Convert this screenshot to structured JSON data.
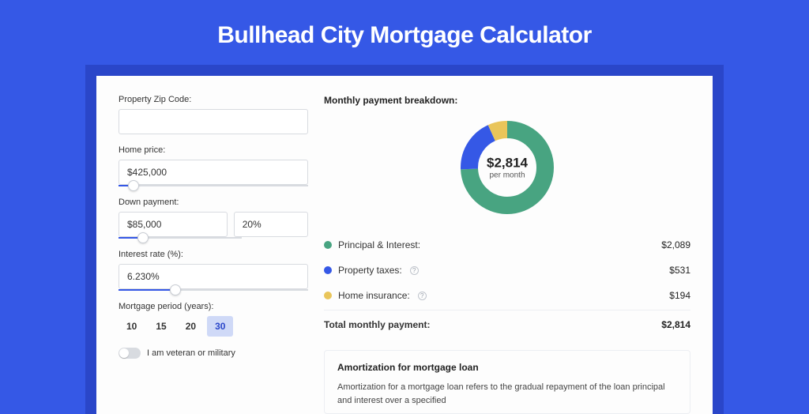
{
  "title": "Bullhead City Mortgage Calculator",
  "form": {
    "zip_label": "Property Zip Code:",
    "zip_value": "",
    "home_price_label": "Home price:",
    "home_price_value": "$425,000",
    "home_price_slider_pct": 8,
    "down_payment_label": "Down payment:",
    "down_payment_value": "$85,000",
    "down_payment_pct_value": "20%",
    "down_payment_slider_pct": 20,
    "interest_label": "Interest rate (%):",
    "interest_value": "6.230%",
    "interest_slider_pct": 30,
    "period_label": "Mortgage period (years):",
    "period_options": [
      "10",
      "15",
      "20",
      "30"
    ],
    "period_selected": "30",
    "veteran_label": "I am veteran or military"
  },
  "breakdown": {
    "title": "Monthly payment breakdown:",
    "total_display": "$2,814",
    "per_month": "per month",
    "rows": [
      {
        "label": "Principal & Interest:",
        "value": "$2,089",
        "color": "green",
        "help": false
      },
      {
        "label": "Property taxes:",
        "value": "$531",
        "color": "blue",
        "help": true
      },
      {
        "label": "Home insurance:",
        "value": "$194",
        "color": "yellow",
        "help": true
      }
    ],
    "total_label": "Total monthly payment:",
    "total_value": "$2,814"
  },
  "chart_data": {
    "type": "pie",
    "title": "Monthly payment breakdown",
    "series": [
      {
        "name": "Principal & Interest",
        "value": 2089,
        "color": "#48a481"
      },
      {
        "name": "Property taxes",
        "value": 531,
        "color": "#3558e6"
      },
      {
        "name": "Home insurance",
        "value": 194,
        "color": "#e9c55a"
      }
    ],
    "total": 2814
  },
  "amortization": {
    "title": "Amortization for mortgage loan",
    "body": "Amortization for a mortgage loan refers to the gradual repayment of the loan principal and interest over a specified"
  }
}
